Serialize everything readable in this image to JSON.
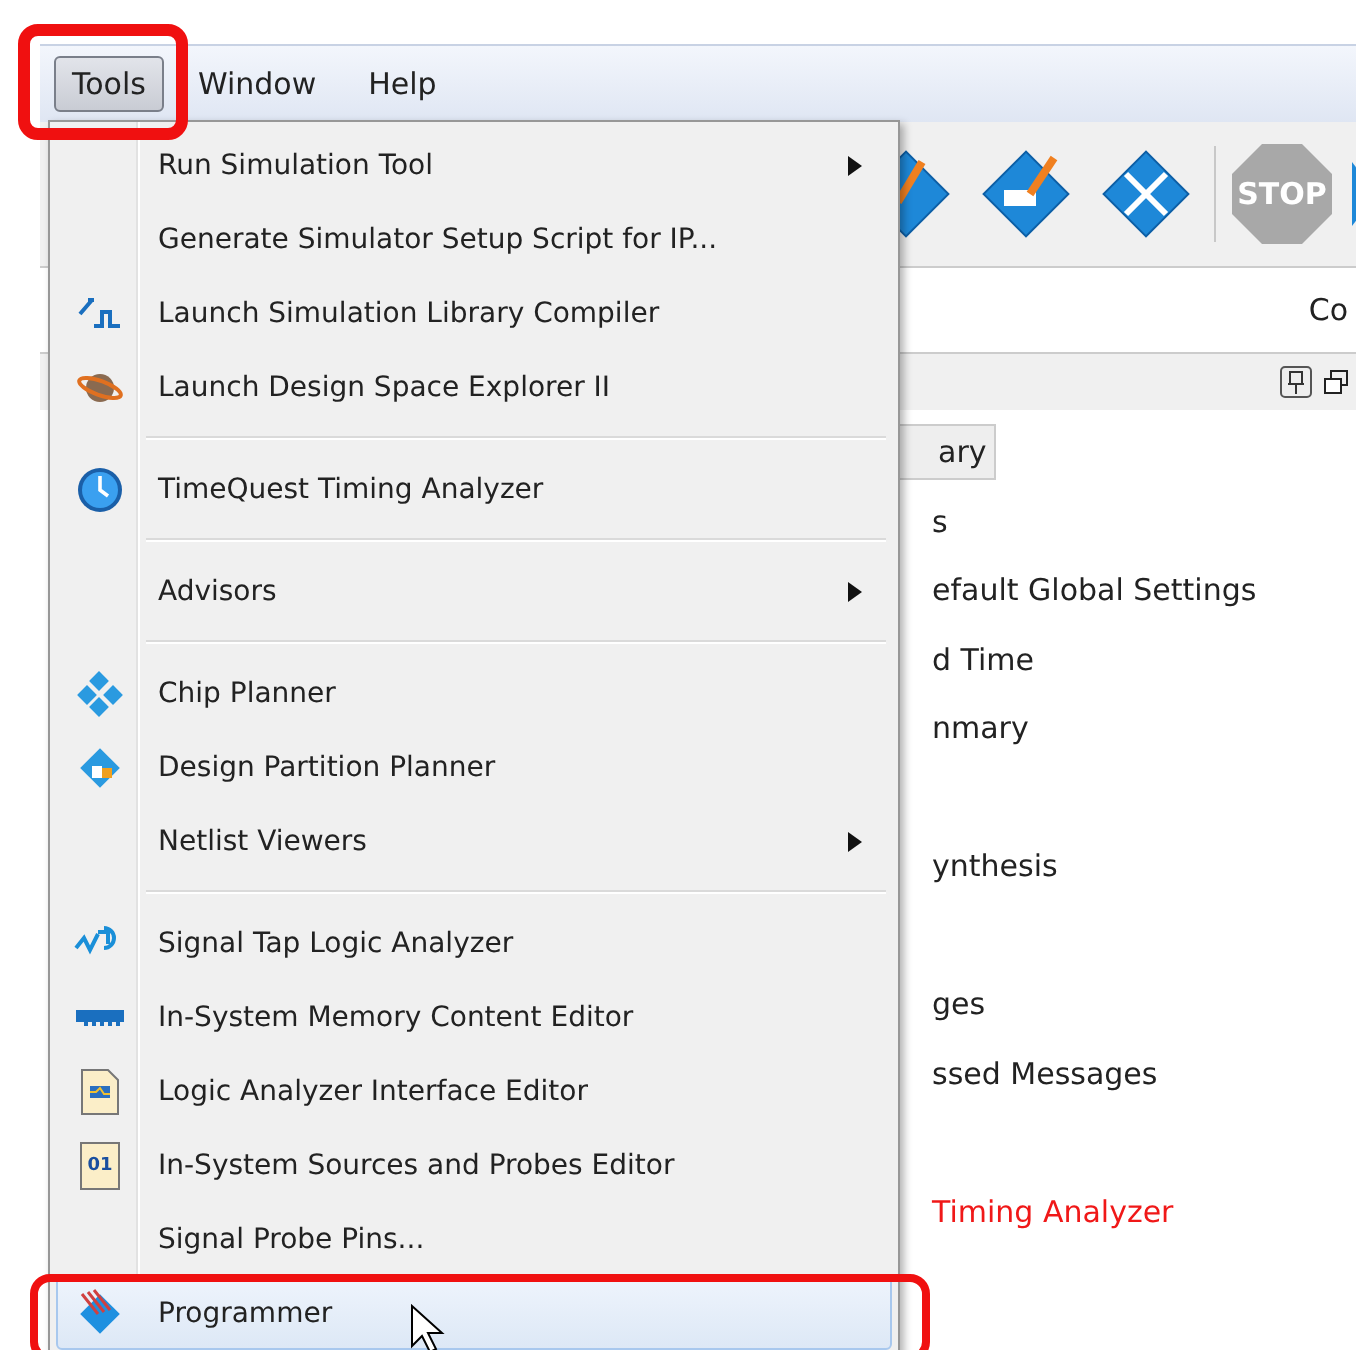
{
  "menu_bar": [
    {
      "label": "Tools",
      "selected": true,
      "highlighted": true
    },
    {
      "label": "Window",
      "selected": false,
      "highlighted": false
    },
    {
      "label": "Help",
      "selected": false,
      "highlighted": false
    }
  ],
  "toolbar": {
    "stop_label": "STOP"
  },
  "pane_header": {
    "column_1": "Co"
  },
  "pane_groups": [
    {
      "rows": [
        {
          "kind": "tab",
          "text": "ary"
        },
        {
          "kind": "text",
          "text": "s"
        },
        {
          "kind": "text",
          "text": "efault Global Settings"
        },
        {
          "kind": "text",
          "text": "d Time"
        },
        {
          "kind": "text",
          "text": "nmary"
        }
      ]
    },
    {
      "rows": [
        {
          "kind": "text",
          "text": "ynthesis"
        }
      ]
    },
    {
      "rows": [
        {
          "kind": "text",
          "text": "ges"
        },
        {
          "kind": "text",
          "text": "ssed Messages"
        }
      ]
    },
    {
      "rows": [
        {
          "kind": "error",
          "text": "Timing Analyzer"
        }
      ]
    }
  ],
  "menu": {
    "items": [
      {
        "kind": "item",
        "label": "Run Simulation Tool",
        "submenu": true,
        "selected": false,
        "highlighted": false
      },
      {
        "kind": "item",
        "label": "Generate Simulator Setup Script for IP...",
        "submenu": false,
        "selected": false,
        "highlighted": false
      },
      {
        "kind": "item",
        "label": "Launch Simulation Library Compiler",
        "submenu": false,
        "selected": false,
        "highlighted": false
      },
      {
        "kind": "item",
        "label": "Launch Design Space Explorer II",
        "submenu": false,
        "selected": false,
        "highlighted": false
      },
      {
        "kind": "separator"
      },
      {
        "kind": "item",
        "label": "TimeQuest Timing Analyzer",
        "submenu": false,
        "selected": false,
        "highlighted": false
      },
      {
        "kind": "separator"
      },
      {
        "kind": "item",
        "label": "Advisors",
        "submenu": true,
        "selected": false,
        "highlighted": false
      },
      {
        "kind": "separator"
      },
      {
        "kind": "item",
        "label": "Chip Planner",
        "submenu": false,
        "selected": false,
        "highlighted": false
      },
      {
        "kind": "item",
        "label": "Design Partition Planner",
        "submenu": false,
        "selected": false,
        "highlighted": false
      },
      {
        "kind": "item",
        "label": "Netlist Viewers",
        "submenu": true,
        "selected": false,
        "highlighted": false
      },
      {
        "kind": "separator"
      },
      {
        "kind": "item",
        "label": "Signal Tap Logic Analyzer",
        "submenu": false,
        "selected": false,
        "highlighted": false
      },
      {
        "kind": "item",
        "label": "In-System Memory Content Editor",
        "submenu": false,
        "selected": false,
        "highlighted": false
      },
      {
        "kind": "item",
        "label": "Logic Analyzer Interface Editor",
        "submenu": false,
        "selected": false,
        "highlighted": false
      },
      {
        "kind": "item",
        "label": "In-System Sources and Probes Editor",
        "icon_text": "01",
        "submenu": false,
        "selected": false,
        "highlighted": false
      },
      {
        "kind": "item",
        "label": "Signal Probe Pins...",
        "submenu": false,
        "selected": false,
        "highlighted": false
      },
      {
        "kind": "item",
        "label": "Programmer",
        "submenu": false,
        "selected": true,
        "highlighted": true
      }
    ]
  }
}
